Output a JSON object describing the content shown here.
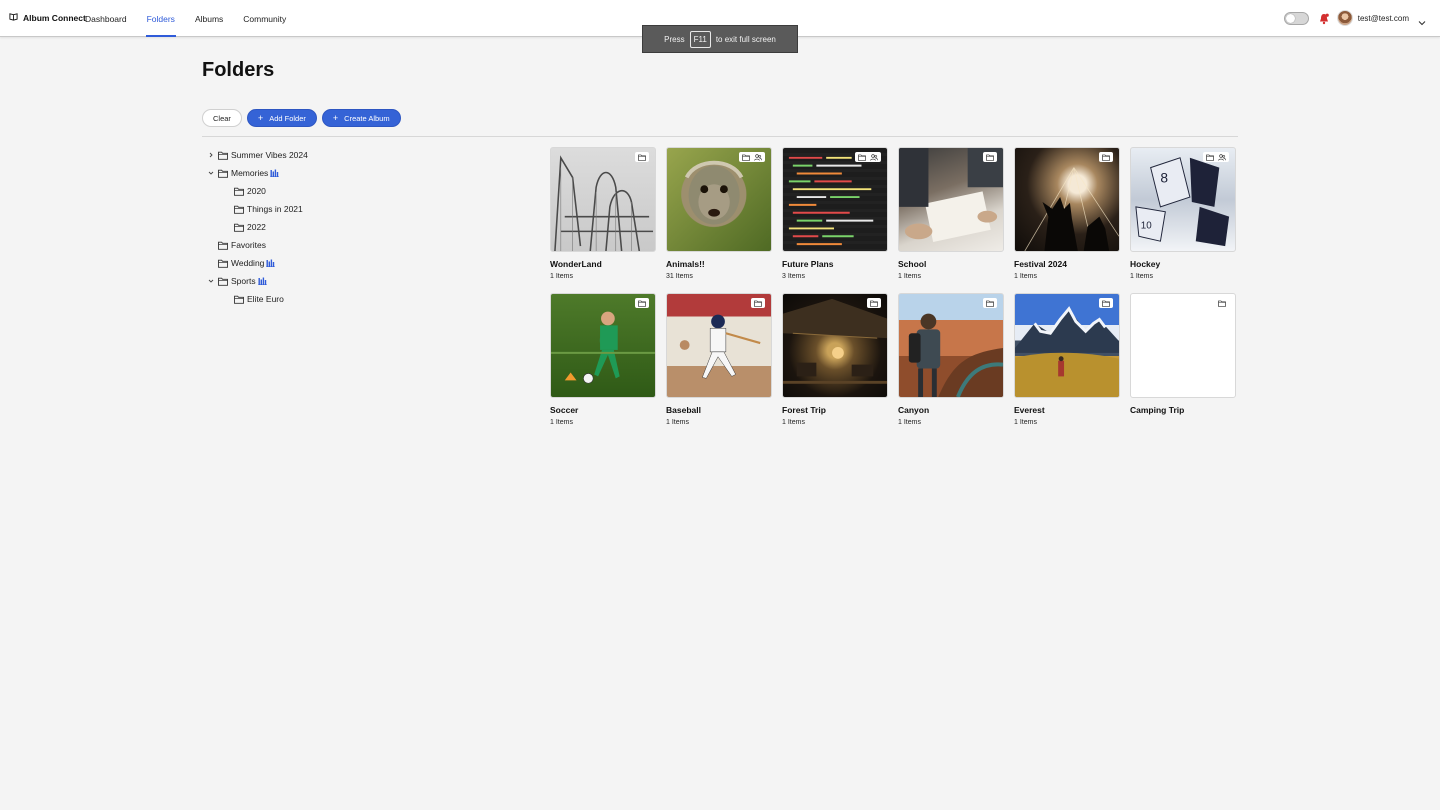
{
  "header": {
    "brand": "Album Connect",
    "nav": [
      {
        "label": "Dashboard",
        "active": false
      },
      {
        "label": "Folders",
        "active": true
      },
      {
        "label": "Albums",
        "active": false
      },
      {
        "label": "Community",
        "active": false
      }
    ],
    "user_email": "test@test.com",
    "accent_color": "#2f5bd9",
    "notification_color": "#d32f2f"
  },
  "toast": {
    "prefix": "Press",
    "key": "F11",
    "suffix": "to exit full screen"
  },
  "page": {
    "title": "Folders",
    "actions": {
      "clear": "Clear",
      "add_folder": "Add Folder",
      "create_album": "Create Album"
    }
  },
  "tree": [
    {
      "label": "Summer Vibes 2024",
      "level": 0,
      "caret": "right",
      "shared": false
    },
    {
      "label": "Memories",
      "level": 0,
      "caret": "down",
      "shared": true
    },
    {
      "label": "2020",
      "level": 1,
      "caret": "none",
      "shared": false
    },
    {
      "label": "Things in 2021",
      "level": 1,
      "caret": "none",
      "shared": false
    },
    {
      "label": "2022",
      "level": 1,
      "caret": "none",
      "shared": false
    },
    {
      "label": "Favorites",
      "level": 0,
      "caret": "none",
      "shared": false
    },
    {
      "label": "Wedding",
      "level": 0,
      "caret": "none",
      "shared": true
    },
    {
      "label": "Sports",
      "level": 0,
      "caret": "down",
      "shared": true
    },
    {
      "label": "Elite Euro",
      "level": 1,
      "caret": "none",
      "shared": false
    }
  ],
  "cards": [
    {
      "title": "WonderLand",
      "count": "1 Items",
      "image": "img-wonder",
      "shared": false
    },
    {
      "title": "Animals!!",
      "count": "31 Items",
      "image": "img-animals",
      "shared": true
    },
    {
      "title": "Future Plans",
      "count": "3 Items",
      "image": "img-future",
      "shared": true
    },
    {
      "title": "School",
      "count": "1 Items",
      "image": "img-school",
      "shared": false
    },
    {
      "title": "Festival 2024",
      "count": "1 Items",
      "image": "img-festival",
      "shared": false
    },
    {
      "title": "Hockey",
      "count": "1 Items",
      "image": "img-hockey",
      "shared": true
    },
    {
      "title": "Soccer",
      "count": "1 Items",
      "image": "img-soccer",
      "shared": false
    },
    {
      "title": "Baseball",
      "count": "1 Items",
      "image": "img-baseball",
      "shared": false
    },
    {
      "title": "Forest Trip",
      "count": "1 Items",
      "image": "img-forest",
      "shared": false
    },
    {
      "title": "Canyon",
      "count": "1 Items",
      "image": "img-canyon",
      "shared": false
    },
    {
      "title": "Everest",
      "count": "1 Items",
      "image": "img-everest",
      "shared": false
    },
    {
      "title": "Camping Trip",
      "count": "",
      "image": "img-camping",
      "shared": false
    }
  ],
  "icons": {
    "brand": "book-icon",
    "folder": "folder-icon",
    "shared": "shared-users-icon",
    "bell": "bell-icon",
    "chevron": "chevron-down-icon"
  }
}
